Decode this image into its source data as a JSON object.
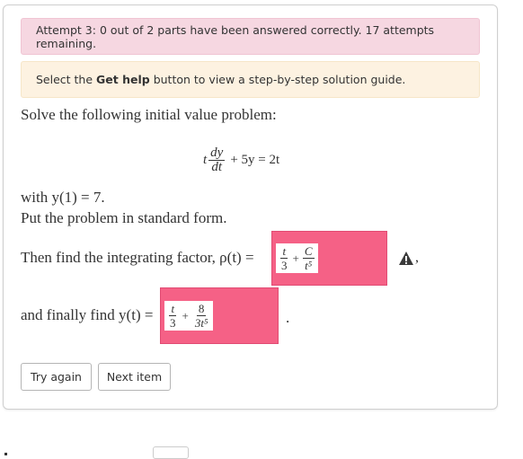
{
  "alerts": {
    "attempt": "Attempt 3: 0 out of 2 parts have been answered correctly. 17 attempts remaining.",
    "help_prefix": "Select the ",
    "help_bold": "Get help",
    "help_suffix": " button to view a step-by-step solution guide."
  },
  "problem": {
    "prompt": "Solve the following initial value problem:",
    "eq_t": "t",
    "eq_num": "dy",
    "eq_den": "dt",
    "eq_rest": "+ 5y = 2t",
    "with": "with y(1) = 7.",
    "standard": "Put the problem in standard form.",
    "then": "Then find the integrating factor, ρ(t) =",
    "comma": ",",
    "final": "and finally find y(t) =",
    "period": "."
  },
  "answers": {
    "integrating_factor": {
      "term1_num": "t",
      "term1_den": "3",
      "plus": "+",
      "term2_num": "C",
      "term2_den": "t⁵",
      "status": "incorrect"
    },
    "solution": {
      "term1_num": "t",
      "term1_den": "3",
      "plus": "+",
      "term2_num": "8",
      "term2_den": "3t⁵",
      "status": "incorrect"
    }
  },
  "icons": {
    "warning": "warning-icon"
  },
  "buttons": {
    "try_again": "Try again",
    "next_item": "Next item"
  },
  "colors": {
    "attempt_bg": "#f6d7e1",
    "help_bg": "#fdf2e1",
    "incorrect": "#f56186"
  }
}
